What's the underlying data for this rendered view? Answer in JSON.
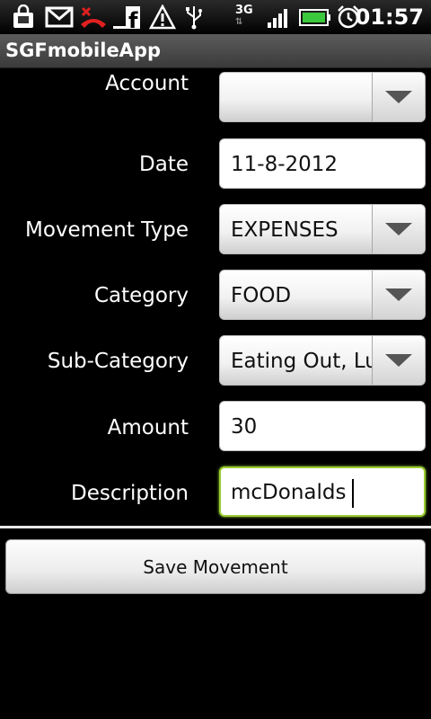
{
  "status_bar": {
    "clock": "01:57",
    "network": "3G",
    "icons": [
      "market-icon",
      "gmail-icon",
      "missed-call-icon",
      "facebook-icon",
      "warning-icon",
      "usb-icon",
      "network-3g-icon",
      "signal-icon",
      "battery-icon",
      "alarm-icon"
    ]
  },
  "app": {
    "title": "SGFmobileApp"
  },
  "form": {
    "account": {
      "label": "Account",
      "value": ""
    },
    "date": {
      "label": "Date",
      "value": "11-8-2012"
    },
    "movement_type": {
      "label": "Movement Type",
      "value": "EXPENSES"
    },
    "category": {
      "label": "Category",
      "value": "FOOD"
    },
    "sub_category": {
      "label": "Sub-Category",
      "value": "Eating Out, Lu"
    },
    "amount": {
      "label": "Amount",
      "value": "30"
    },
    "description": {
      "label": "Description",
      "value": "mcDonalds"
    }
  },
  "actions": {
    "save_label": "Save Movement"
  },
  "colors": {
    "focus_border": "#9acd32",
    "battery": "#3cc83c"
  }
}
